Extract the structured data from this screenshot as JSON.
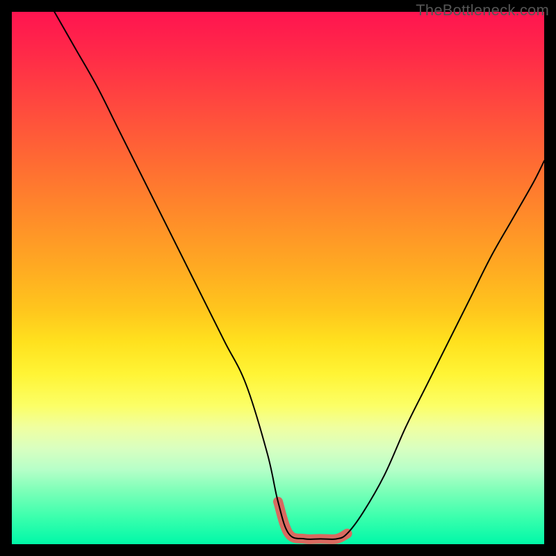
{
  "watermark": "TheBottleneck.com",
  "chart_data": {
    "type": "line",
    "title": "",
    "xlabel": "",
    "ylabel": "",
    "xlim": [
      0,
      100
    ],
    "ylim": [
      0,
      100
    ],
    "grid": false,
    "legend": false,
    "series": [
      {
        "name": "bottleneck-curve",
        "x": [
          8,
          12,
          16,
          20,
          24,
          28,
          32,
          36,
          40,
          44,
          48,
          50,
          52,
          55,
          58,
          61,
          63,
          66,
          70,
          74,
          78,
          82,
          86,
          90,
          94,
          98,
          100
        ],
        "values": [
          100,
          93,
          86,
          78,
          70,
          62,
          54,
          46,
          38,
          30,
          17,
          8,
          2,
          1,
          1,
          1,
          2,
          6,
          13,
          22,
          30,
          38,
          46,
          54,
          61,
          68,
          72
        ]
      }
    ],
    "highlight": {
      "name": "optimal-range",
      "x": [
        50,
        52,
        55,
        58,
        61,
        63
      ],
      "values": [
        8,
        2,
        1,
        1,
        1,
        2
      ]
    },
    "background": {
      "type": "vertical-gradient",
      "stops": [
        {
          "pos": 0,
          "color": "#ff1450"
        },
        {
          "pos": 8,
          "color": "#ff2a48"
        },
        {
          "pos": 18,
          "color": "#ff4a3e"
        },
        {
          "pos": 28,
          "color": "#ff6a33"
        },
        {
          "pos": 38,
          "color": "#ff8a2a"
        },
        {
          "pos": 48,
          "color": "#ffaa22"
        },
        {
          "pos": 56,
          "color": "#ffc61d"
        },
        {
          "pos": 62,
          "color": "#ffe11e"
        },
        {
          "pos": 68,
          "color": "#fff435"
        },
        {
          "pos": 74,
          "color": "#fcff66"
        },
        {
          "pos": 78,
          "color": "#f0ffa0"
        },
        {
          "pos": 82,
          "color": "#d9ffc0"
        },
        {
          "pos": 86,
          "color": "#b6ffc8"
        },
        {
          "pos": 90,
          "color": "#7cffb8"
        },
        {
          "pos": 95,
          "color": "#3affad"
        },
        {
          "pos": 100,
          "color": "#00f8a8"
        }
      ]
    }
  }
}
